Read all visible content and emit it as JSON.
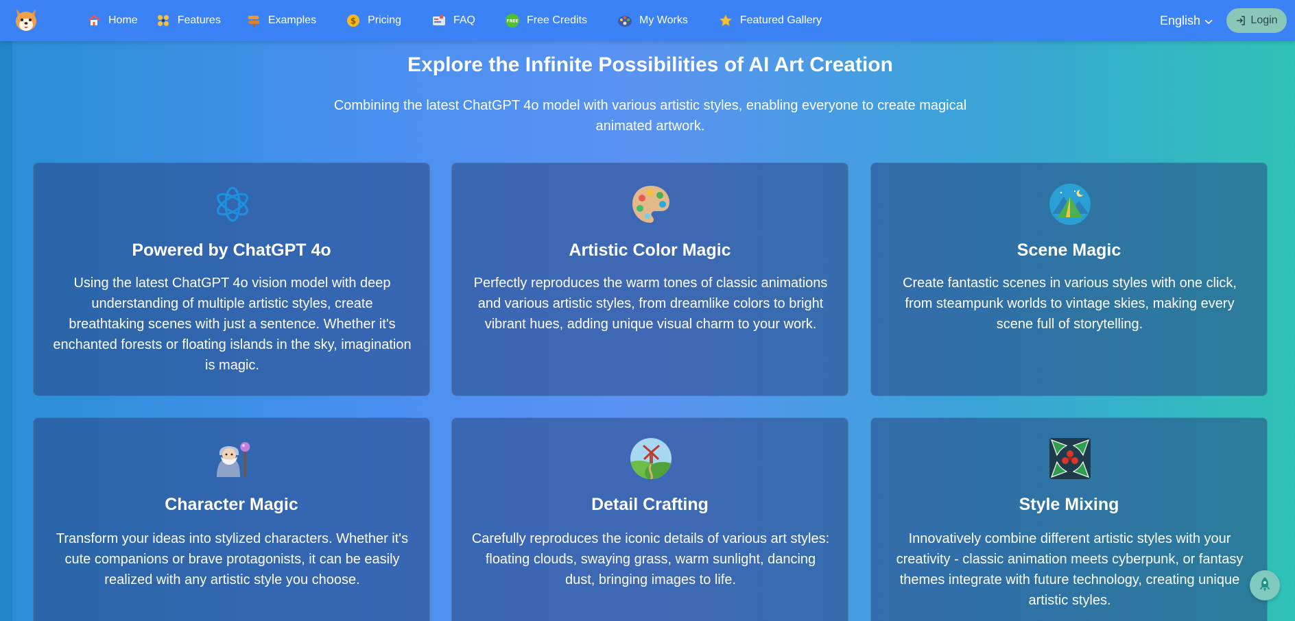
{
  "nav": {
    "items": [
      {
        "label": "Home",
        "icon": "home-icon"
      },
      {
        "label": "Features",
        "icon": "features-icon"
      },
      {
        "label": "Examples",
        "icon": "signpost-icon"
      },
      {
        "label": "Pricing",
        "icon": "dollar-coin-icon"
      },
      {
        "label": "FAQ",
        "icon": "faq-icon"
      },
      {
        "label": "Free Credits",
        "icon": "free-badge-icon"
      },
      {
        "label": "My Works",
        "icon": "artist-palette-icon"
      },
      {
        "label": "Featured Gallery",
        "icon": "star-icon"
      }
    ],
    "language": "English",
    "login_label": "Login"
  },
  "hero": {
    "title": "Explore the Infinite Possibilities of AI Art Creation",
    "subtitle": "Combining the latest ChatGPT 4o model with various artistic styles, enabling everyone to create magical animated artwork."
  },
  "features": [
    {
      "title": "Powered by ChatGPT 4o",
      "icon": "openai-logo-icon",
      "description": "Using the latest ChatGPT 4o vision model with deep understanding of multiple artistic styles, create breathtaking scenes with just a sentence. Whether it's enchanted forests or floating islands in the sky, imagination is magic."
    },
    {
      "title": "Artistic Color Magic",
      "icon": "paint-palette-icon",
      "description": "Perfectly reproduces the warm tones of classic animations and various artistic styles, from dreamlike colors to bright vibrant hues, adding unique visual charm to your work."
    },
    {
      "title": "Scene Magic",
      "icon": "camping-tent-icon",
      "description": "Create fantastic scenes in various styles with one click, from steampunk worlds to vintage skies, making every scene full of storytelling."
    },
    {
      "title": "Character Magic",
      "icon": "wizard-icon",
      "description": "Transform your ideas into stylized characters. Whether it's cute companions or brave protagonists, it can be easily realized with any artistic style you choose."
    },
    {
      "title": "Detail Crafting",
      "icon": "windmill-landscape-icon",
      "description": "Carefully reproduces the iconic details of various art styles: floating clouds, swaying grass, warm sunlight, dancing dust, bringing images to life."
    },
    {
      "title": "Style Mixing",
      "icon": "holly-mix-icon",
      "description": "Innovatively combine different artistic styles with your creativity - classic animation meets cyberpunk, or fantasy themes integrate with future technology, creating unique artistic styles."
    }
  ],
  "fab_icon": "rocket-icon"
}
